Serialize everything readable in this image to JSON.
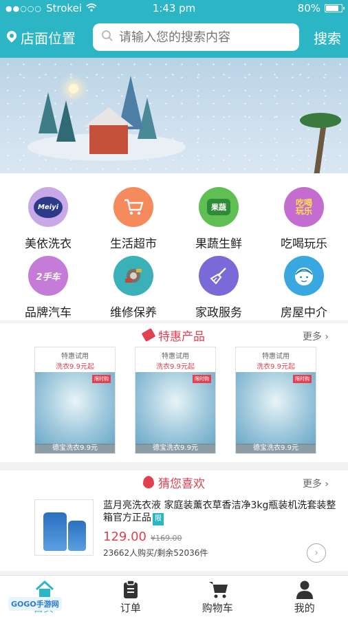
{
  "status_bar": {
    "carrier": "Strokei",
    "time": "1:43 pm",
    "battery": "80%",
    "battery_level": 0.8
  },
  "header": {
    "location": "店面位置",
    "search_placeholder": "请输入您的搜索内容",
    "search_button": "搜索"
  },
  "categories": [
    {
      "label": "美依洗衣",
      "color": "#c9a8e8",
      "icon": "meiyi-logo-icon",
      "icon_text": "Meiyi"
    },
    {
      "label": "生活超市",
      "color": "#f58a5c",
      "icon": "cart-icon",
      "icon_text": ""
    },
    {
      "label": "果蔬生鲜",
      "color": "#5fbf52",
      "icon": "fruit-icon",
      "icon_text": "果蔬"
    },
    {
      "label": "吃喝玩乐",
      "color": "#c46ccf",
      "icon": "fun-icon",
      "icon_text": "吃喝玩乐"
    },
    {
      "label": "品牌汽车",
      "color": "#c57bd8",
      "icon": "car-brand-icon",
      "icon_text": "2手车"
    },
    {
      "label": "维修保养",
      "color": "#3ab0b8",
      "icon": "repair-icon",
      "icon_text": ""
    },
    {
      "label": "家政服务",
      "color": "#7a6ad8",
      "icon": "broom-icon",
      "icon_text": ""
    },
    {
      "label": "房屋中介",
      "color": "#39a8e0",
      "icon": "agent-face-icon",
      "icon_text": ""
    }
  ],
  "special": {
    "title": "特惠产品",
    "more": "更多",
    "products": [
      {
        "title": "特惠试用",
        "subtitle": "洗衣9.9元起",
        "flag": "限时购",
        "caption": "德宝洗衣9.9元"
      },
      {
        "title": "特惠试用",
        "subtitle": "洗衣9.9元起",
        "flag": "限时购",
        "caption": "德宝洗衣9.9元"
      },
      {
        "title": "特惠试用",
        "subtitle": "洗衣9.9元起",
        "flag": "限时购",
        "caption": "德宝洗衣9.9元"
      }
    ]
  },
  "guess": {
    "title": "猜您喜欢",
    "more": "更多",
    "item": {
      "title": "蓝月亮洗衣液 家庭装薰衣草香洁净3kg瓶装机洗套装整箱官方正品",
      "badge": "限",
      "price": "129.00",
      "old_price": "¥169.00",
      "sold": "23662人购买/剩余52036件"
    }
  },
  "tabbar": {
    "items": [
      "首页",
      "订单",
      "购物车",
      "我的"
    ]
  },
  "watermark": "GOGO手游网"
}
